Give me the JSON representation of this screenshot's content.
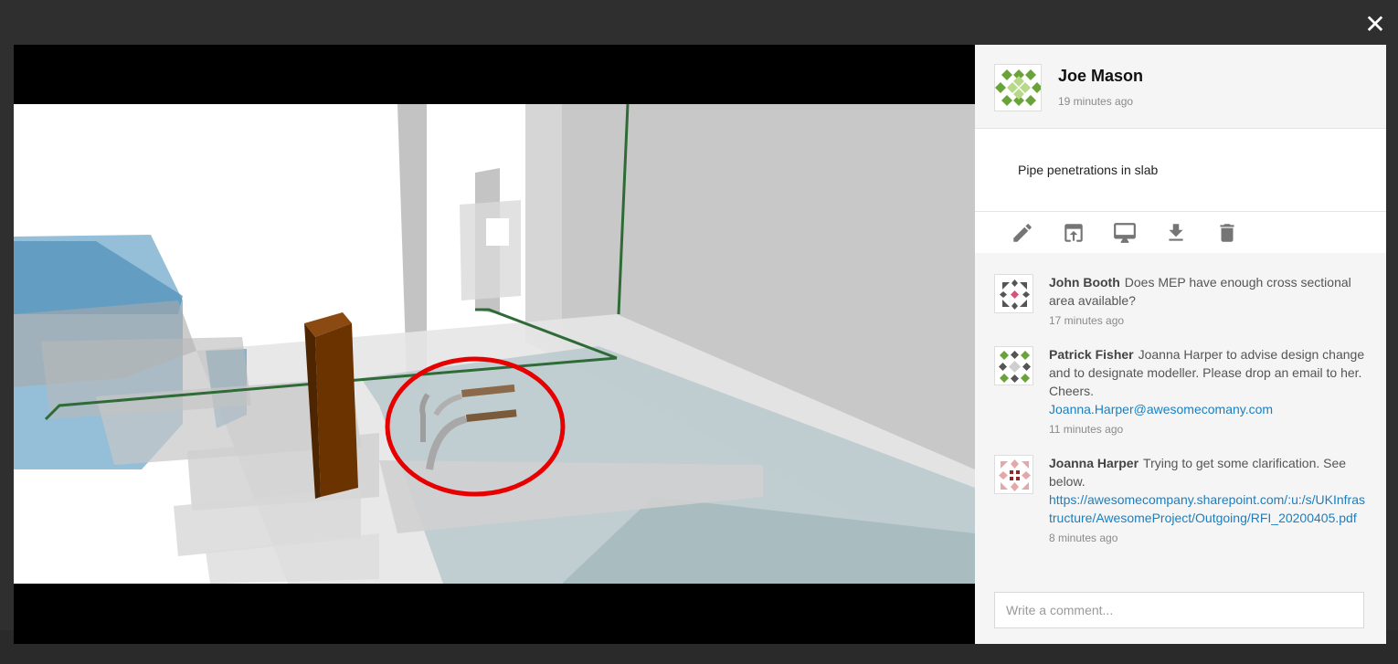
{
  "close_label": "✕",
  "post": {
    "author": "Joe Mason",
    "time": "19 minutes ago",
    "description": "Pipe penetrations in slab"
  },
  "toolbar": [
    {
      "name": "edit-icon",
      "icon": "pencil"
    },
    {
      "name": "open-in-new-icon",
      "icon": "open-in-new"
    },
    {
      "name": "monitor-icon",
      "icon": "desktop"
    },
    {
      "name": "download-icon",
      "icon": "download"
    },
    {
      "name": "delete-icon",
      "icon": "trash"
    }
  ],
  "comments": [
    {
      "author": "John Booth",
      "text": "Does MEP have enough cross sectional area available?",
      "link": "",
      "time": "17 minutes ago"
    },
    {
      "author": "Patrick Fisher",
      "text": "Joanna Harper to advise design change and to designate modeller. Please drop an email to her. Cheers.",
      "link": "Joanna.Harper@awesomecomany.com",
      "time": "11 minutes ago"
    },
    {
      "author": "Joanna Harper",
      "text": "Trying to get some clarification. See below.",
      "link": "https://awesomecompany.sharepoint.com/:u:/s/UKInfrastructure/AwesomeProject/Outgoing/RFI_20200405.pdf",
      "time": "8 minutes ago"
    }
  ],
  "comment_input": {
    "placeholder": "Write a comment..."
  },
  "colors": {
    "link": "#1a7fc1",
    "panel_bg": "#f5f5f5",
    "highlight": "#e60000",
    "column": "#6b3300"
  }
}
